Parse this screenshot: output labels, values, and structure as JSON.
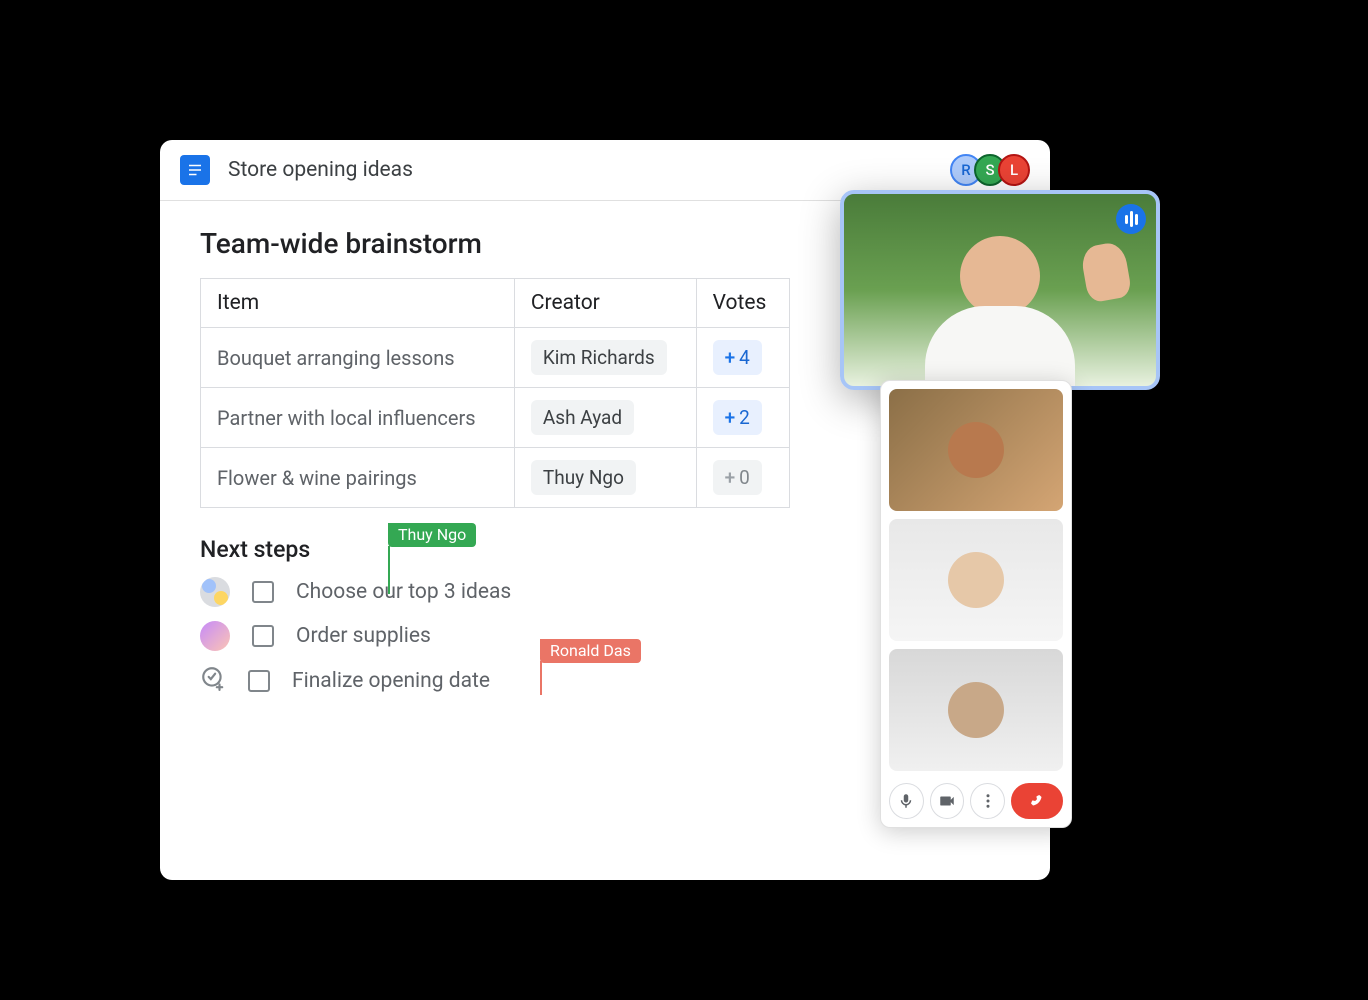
{
  "document": {
    "title": "Store opening ideas",
    "heading": "Team-wide brainstorm",
    "table": {
      "headers": {
        "item": "Item",
        "creator": "Creator",
        "votes": "Votes"
      },
      "rows": [
        {
          "item": "Bouquet arranging lessons",
          "creator": "Kim Richards",
          "votes": "4",
          "highlight": true
        },
        {
          "item": "Partner with local influencers",
          "creator": "Ash Ayad",
          "votes": "2",
          "highlight": true
        },
        {
          "item": "Flower & wine pairings",
          "creator": "Thuy Ngo",
          "votes": "0",
          "highlight": false
        }
      ]
    },
    "subheading": "Next steps",
    "steps": [
      {
        "label": "Choose our top 3 ideas"
      },
      {
        "label": "Order supplies"
      },
      {
        "label": "Finalize opening date"
      }
    ]
  },
  "cursors": {
    "green": {
      "name": "Thuy Ngo"
    },
    "red": {
      "name": "Ronald Das"
    }
  },
  "presence": [
    {
      "initial": "R",
      "bg": "#aecbfa",
      "fg": "#1967d2",
      "ring": "#4285f4"
    },
    {
      "initial": "S",
      "bg": "#34a853",
      "fg": "#ffffff",
      "ring": "#0d652d"
    },
    {
      "initial": "L",
      "bg": "#ea4335",
      "fg": "#ffffff",
      "ring": "#b31412"
    }
  ]
}
